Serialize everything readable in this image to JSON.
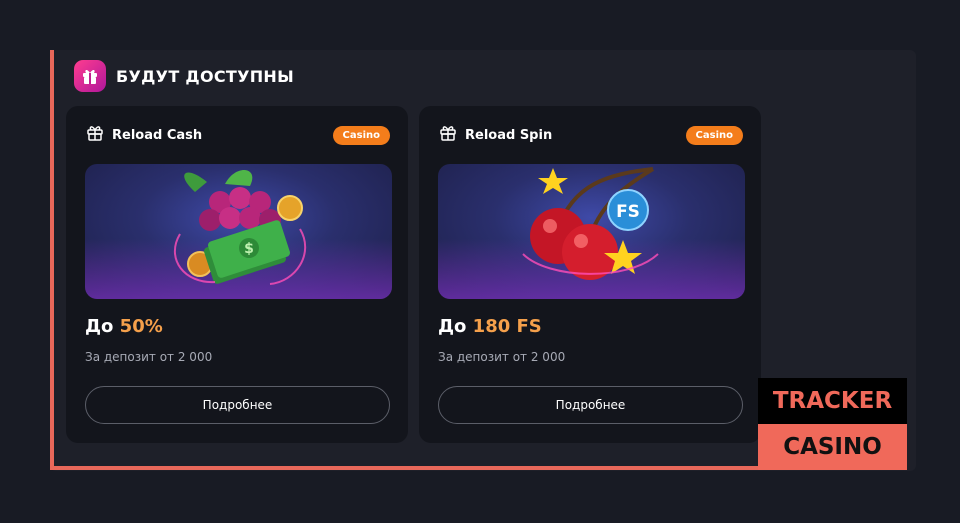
{
  "section": {
    "title": "БУДУТ ДОСТУПНЫ",
    "icon": "gift-icon"
  },
  "cards": [
    {
      "title": "Reload Cash",
      "tag": "Casino",
      "amount_prefix": "До ",
      "amount_value": "50%",
      "subtitle": "За депозит от 2 000",
      "button": "Подробнее",
      "image": "grapes-cash-illustration"
    },
    {
      "title": "Reload Spin",
      "tag": "Casino",
      "amount_prefix": "До ",
      "amount_value": "180 FS",
      "subtitle": "За депозит от 2 000",
      "button": "Подробнее",
      "image": "cherries-fs-illustration",
      "image_badge": "FS"
    }
  ],
  "watermark": {
    "line1": "TRACKER",
    "line2": "CASINO"
  },
  "colors": {
    "accent": "#e8685a",
    "tag": "#f47d1b",
    "highlight": "#f5a04b",
    "card_bg": "#13151c",
    "panel_bg": "#1e2029"
  }
}
